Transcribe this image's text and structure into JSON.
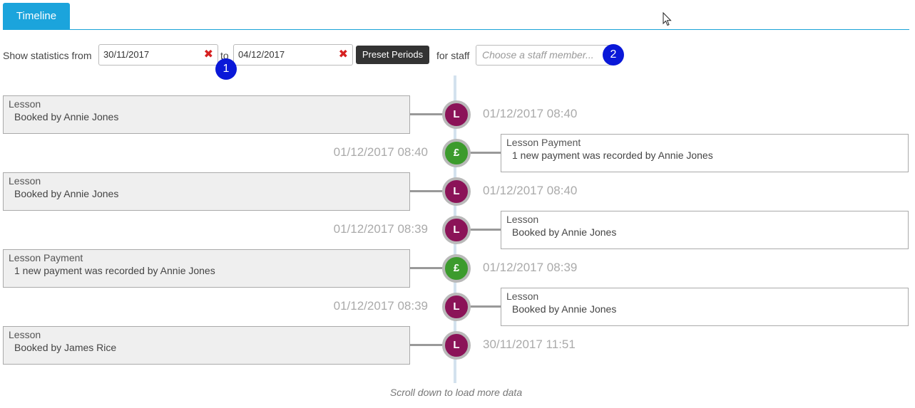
{
  "tabs": {
    "timeline": "Timeline"
  },
  "filter": {
    "show_from_label": "Show statistics from",
    "from_date": "30/11/2017",
    "to_label": "to",
    "to_date": "04/12/2017",
    "clear_glyph": "✖",
    "preset_button": "Preset Periods",
    "staff_label": "for staff",
    "staff_placeholder": "Choose a staff member..."
  },
  "badges": {
    "one": "1",
    "two": "2"
  },
  "node_glyphs": {
    "lesson": "L",
    "payment": "£"
  },
  "events": [
    {
      "side": "left",
      "type": "lesson",
      "title": "Lesson",
      "description": "Booked by Annie Jones",
      "time": "01/12/2017 08:40"
    },
    {
      "side": "right",
      "type": "payment",
      "title": "Lesson Payment",
      "description": "1 new payment was recorded by Annie Jones",
      "time": "01/12/2017 08:40"
    },
    {
      "side": "left",
      "type": "lesson",
      "title": "Lesson",
      "description": "Booked by Annie Jones",
      "time": "01/12/2017 08:40"
    },
    {
      "side": "right",
      "type": "lesson",
      "title": "Lesson",
      "description": "Booked by Annie Jones",
      "time": "01/12/2017 08:39"
    },
    {
      "side": "left",
      "type": "payment",
      "title": "Lesson Payment",
      "description": "1 new payment was recorded by Annie Jones",
      "time": "01/12/2017 08:39"
    },
    {
      "side": "right",
      "type": "lesson",
      "title": "Lesson",
      "description": "Booked by Annie Jones",
      "time": "01/12/2017 08:39"
    },
    {
      "side": "left",
      "type": "lesson",
      "title": "Lesson",
      "description": "Booked by James Rice",
      "time": "30/11/2017 11:51"
    }
  ],
  "scroll_hint": "Scroll down to load more data",
  "colors": {
    "tab_accent": "#1ba4dc",
    "lesson_node": "#8b1358",
    "payment_node": "#3c9b2d",
    "badge": "#0a18d8",
    "clear_x": "#d62020"
  }
}
